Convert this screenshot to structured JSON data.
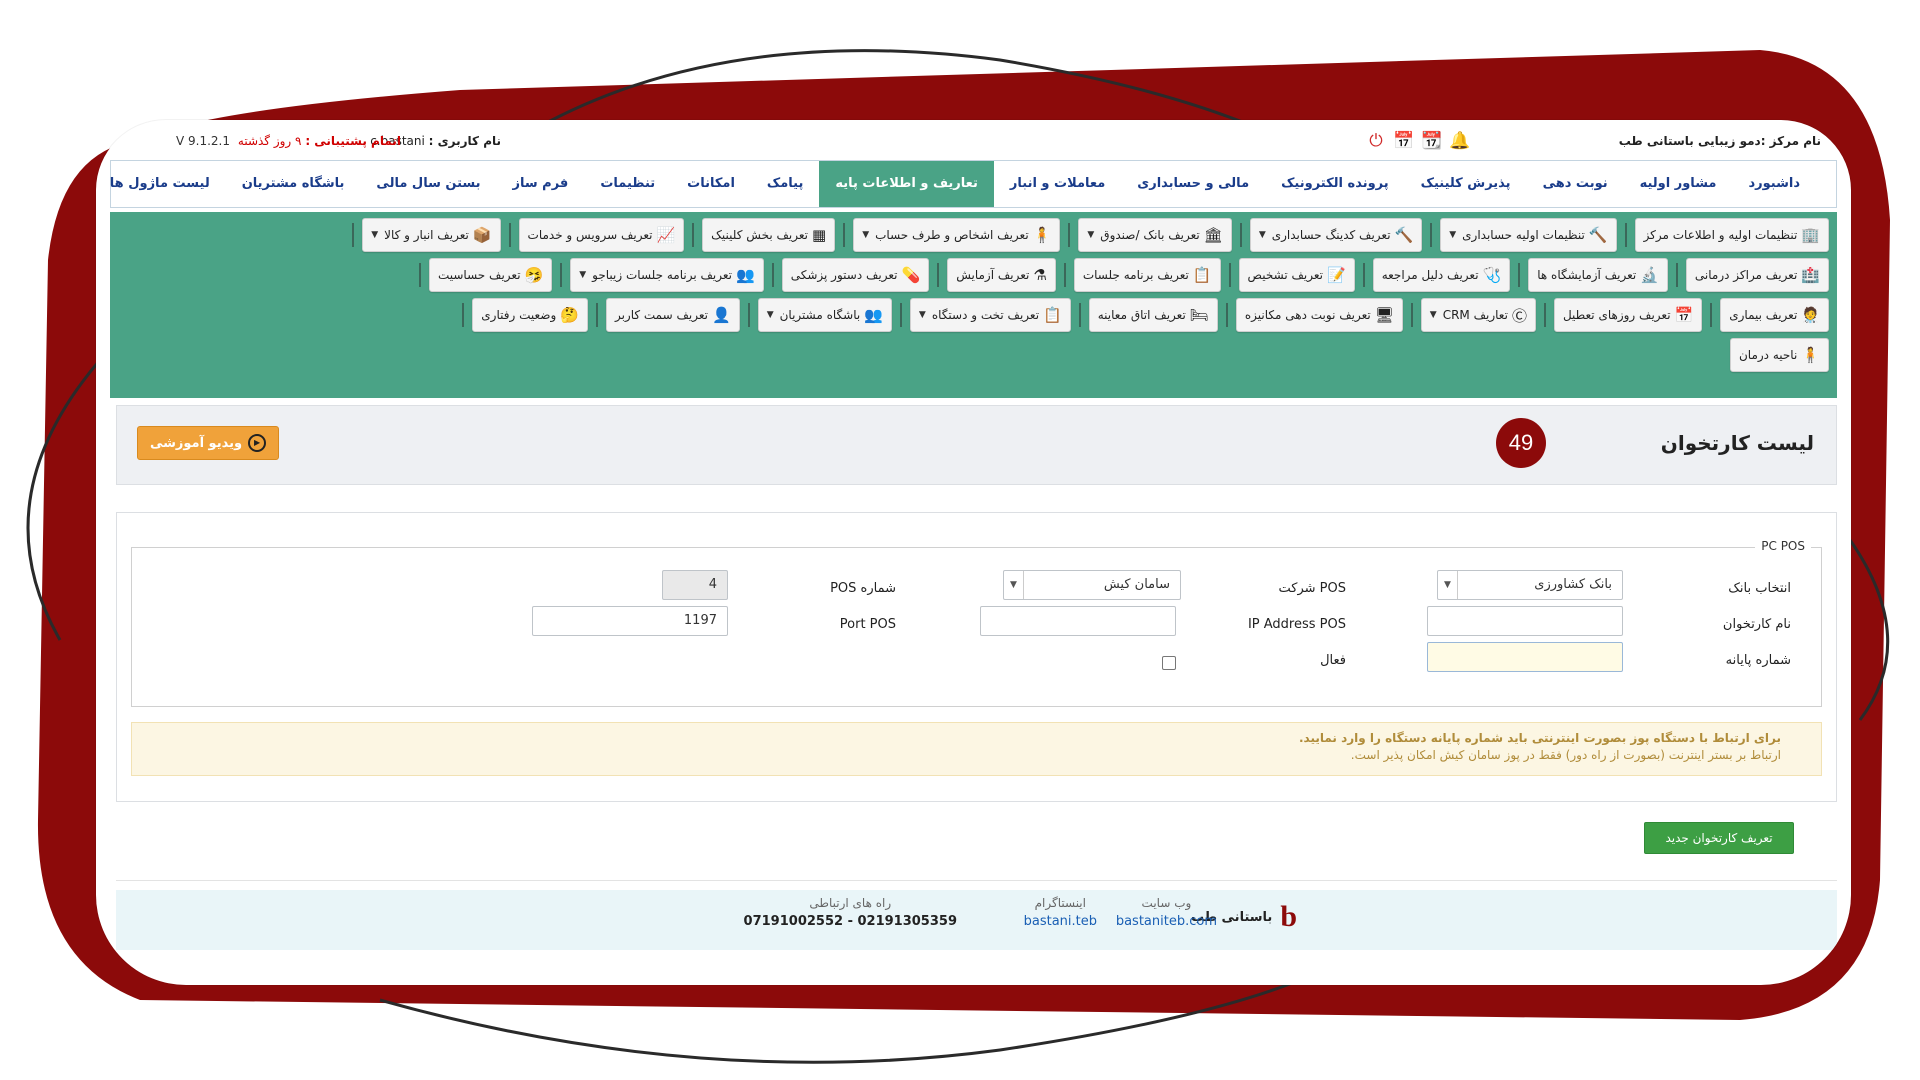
{
  "colors": {
    "frame_red": "#8c0a0a",
    "menu_green": "#4aa386",
    "active_nav": "#4aa386",
    "warning_text": "#d00000",
    "video_button": "#f0a23a",
    "new_button": "#3d9f44"
  },
  "topbar": {
    "center_label": "نام مرکز :دمو زیبایی باستانی طب",
    "user_label": "نام کاربری :",
    "user_value": "c.bastani",
    "warning_label": "اتمام پشتیبانی :",
    "warning_value": "۹ روز گذشته",
    "version": "V 9.1.2.1",
    "icons": [
      "power-icon",
      "calendar-check-icon",
      "calendar-icon",
      "bell-icon"
    ]
  },
  "mainnav": {
    "items": [
      "داشبورد",
      "مشاور اولیه",
      "نوبت دهی",
      "پذیرش کلینیک",
      "پرونده الکترونیک",
      "مالی و حسابداری",
      "معاملات و انبار",
      "تعاریف و اطلاعات پایه",
      "پیامک",
      "امکانات",
      "تنظیمات",
      "فرم ساز",
      "بستن سال مالی",
      "باشگاه مشتریان",
      "لیست ماژول ها"
    ],
    "active_index": 7
  },
  "submenu": {
    "rows": [
      [
        {
          "label": "تنظیمات اولیه و اطلاعات مرکز",
          "icon": "🏢",
          "caret": false
        },
        {
          "label": "تنظیمات اولیه حسابداری",
          "icon": "🔨",
          "caret": true
        },
        {
          "label": "تعریف کدینگ حسابداری",
          "icon": "🔨",
          "caret": true
        },
        {
          "label": "تعریف بانک /صندوق",
          "icon": "🏛",
          "caret": true
        },
        {
          "label": "تعریف اشخاص و طرف حساب",
          "icon": "🧍",
          "caret": true
        },
        {
          "label": "تعریف بخش کلینیک",
          "icon": "▦",
          "caret": false
        },
        {
          "label": "تعریف سرویس و خدمات",
          "icon": "📈",
          "caret": false
        },
        {
          "label": "تعریف انبار و کالا",
          "icon": "📦",
          "caret": true
        }
      ],
      [
        {
          "label": "تعریف مراکز درمانی",
          "icon": "🏥",
          "caret": false
        },
        {
          "label": "تعریف آزمایشگاه ها",
          "icon": "🔬",
          "caret": false
        },
        {
          "label": "تعریف دلیل مراجعه",
          "icon": "🩺",
          "caret": false
        },
        {
          "label": "تعریف تشخیص",
          "icon": "📝",
          "caret": false
        },
        {
          "label": "تعریف برنامه جلسات",
          "icon": "📋",
          "caret": false
        },
        {
          "label": "تعریف آزمایش",
          "icon": "⚗",
          "caret": false
        },
        {
          "label": "تعریف دستور پزشکی",
          "icon": "💊",
          "caret": false
        },
        {
          "label": "تعریف برنامه جلسات زیباجو",
          "icon": "👥",
          "caret": true
        },
        {
          "label": "تعریف حساسیت",
          "icon": "🤧",
          "caret": false
        }
      ],
      [
        {
          "label": "تعریف بیماری",
          "icon": "🧑‍⚕",
          "caret": false
        },
        {
          "label": "تعریف روزهای تعطیل",
          "icon": "📅",
          "caret": false
        },
        {
          "label": "تعاریف CRM",
          "icon": "Ⓒ",
          "caret": true
        },
        {
          "label": "تعریف نوبت دهی مکانیزه",
          "icon": "🖥",
          "caret": false
        },
        {
          "label": "تعریف اتاق معاینه",
          "icon": "🛏",
          "caret": false
        },
        {
          "label": "تعریف تخت و دستگاه",
          "icon": "📋",
          "caret": true
        },
        {
          "label": "باشگاه مشتریان",
          "icon": "👥",
          "caret": true
        },
        {
          "label": "تعریف سمت کاربر",
          "icon": "👤",
          "caret": false
        },
        {
          "label": "وضعیت رفتاری",
          "icon": "🤔",
          "caret": false
        }
      ],
      [
        {
          "label": "ناحیه درمان",
          "icon": "🧍",
          "caret": false
        }
      ]
    ]
  },
  "page": {
    "title": "لیست کارتخوان",
    "badge": "49",
    "video_button": "ویدیو آموزشی"
  },
  "form": {
    "legend": "PC POS",
    "bank_label": "انتخاب بانک",
    "bank_value": "بانک کشاورزی",
    "company_label": "شرکت POS",
    "company_value": "سامان کیش",
    "pos_number_label": "شماره POS",
    "pos_number_value": "4",
    "name_label": "نام کارتخوان",
    "name_value": "",
    "ip_label": "IP Address POS",
    "ip_value": "",
    "port_label": "Port POS",
    "port_value": "1197",
    "terminal_label": "شماره پایانه",
    "terminal_value": "",
    "active_label": "فعال",
    "active_checked": false
  },
  "alert": {
    "line1": "برای ارتباط با دستگاه پوز بصورت اینترنتی باید شماره پایانه دستگاه را وارد نمایید.",
    "line2": "ارتباط بر بستر اینترنت (بصورت از راه دور) فقط در پوز سامان کیش امکان پذیر است."
  },
  "actions": {
    "new_button": "تعریف کارتخوان جدید"
  },
  "footer": {
    "brand": "باستانی طب",
    "website_label": "وب سایت",
    "website_value": "bastaniteb.com",
    "instagram_label": "اینستاگرام",
    "instagram_value": "bastani.teb",
    "contact_label": "راه های ارتباطی",
    "contact_value": "07191002552 - 02191305359"
  }
}
